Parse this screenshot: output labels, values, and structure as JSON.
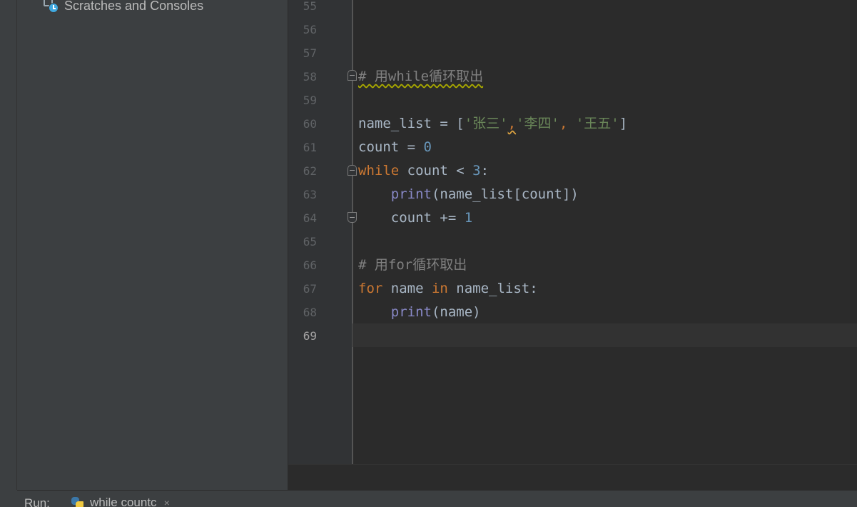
{
  "project_panel": {
    "scratches_label": "Scratches and Consoles"
  },
  "editor": {
    "line_numbers": [
      "55",
      "56",
      "57",
      "58",
      "59",
      "60",
      "61",
      "62",
      "63",
      "64",
      "65",
      "66",
      "67",
      "68",
      "69"
    ],
    "current_line": "69",
    "code": {
      "l58_comment": "# 用while循环取出",
      "l60_name": "name_list",
      "l60_eq": " = [",
      "l60_s1": "'张三'",
      "l60_c1": ",",
      "l60_s2": "'李四'",
      "l60_c2": ", ",
      "l60_s3": "'王五'",
      "l60_end": "]",
      "l61_var": "count",
      "l61_eq": " = ",
      "l61_num": "0",
      "l62_kw": "while",
      "l62_rest": " count < ",
      "l62_num": "3",
      "l62_colon": ":",
      "l63_indent": "    ",
      "l63_fn": "print",
      "l63_args": "(name_list[count])",
      "l64_indent": "    ",
      "l64_stmt": "count += ",
      "l64_num": "1",
      "l66_comment": "# 用for循环取出",
      "l67_kw1": "for",
      "l67_mid": " name ",
      "l67_kw2": "in",
      "l67_end": " name_list:",
      "l68_indent": "    ",
      "l68_fn": "print",
      "l68_args": "(name)"
    }
  },
  "bottom_bar": {
    "run_label": "Run:",
    "run_tab_label": "while countc",
    "close_glyph": "×"
  },
  "icons": {
    "scratches": "scratches-clock-icon",
    "python": "python-icon"
  }
}
